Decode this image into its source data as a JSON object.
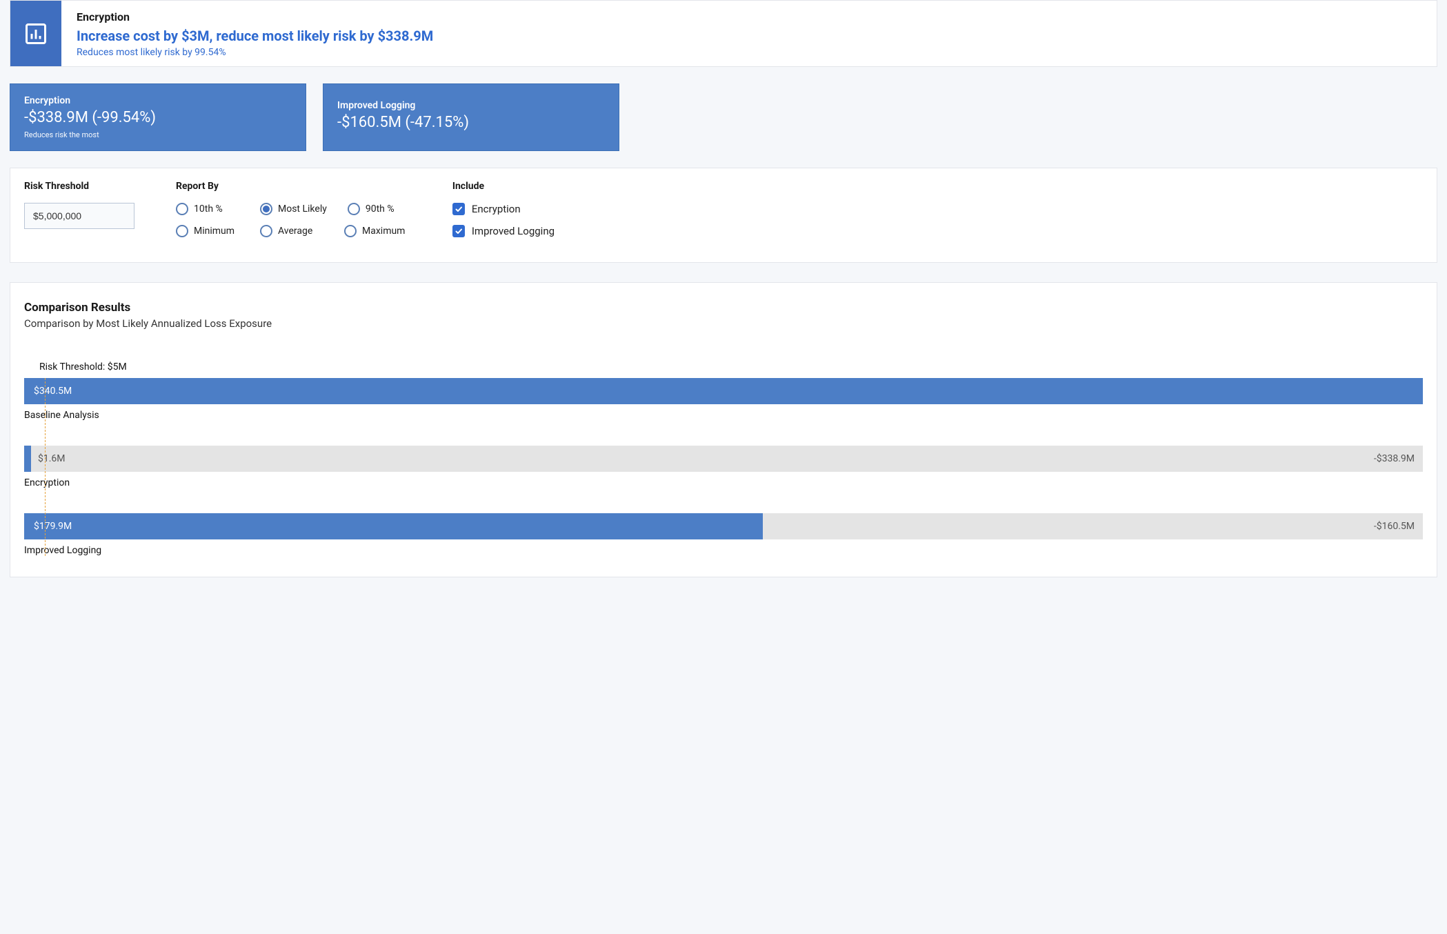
{
  "palette": {
    "primary": "#4c7ec6",
    "primary_dark": "#3f6ebf",
    "link": "#2f6ad0",
    "bar_bg": "#e4e4e4",
    "threshold_line": "#e6a23c"
  },
  "banner": {
    "title": "Encryption",
    "headline": "Increase cost by $3M, reduce most likely risk by $338.9M",
    "sub": "Reduces most likely risk by 99.54%"
  },
  "metric_cards": [
    {
      "title": "Encryption",
      "value": "-$338.9M (-99.54%)",
      "caption": "Reduces risk the most"
    },
    {
      "title": "Improved Logging",
      "value": "-$160.5M (-47.15%)",
      "caption": ""
    }
  ],
  "controls": {
    "risk_threshold_label": "Risk Threshold",
    "risk_threshold_value": "$5,000,000",
    "report_by_label": "Report By",
    "report_by_options": [
      {
        "label": "10th %",
        "checked": false
      },
      {
        "label": "Most Likely",
        "checked": true
      },
      {
        "label": "90th %",
        "checked": false
      },
      {
        "label": "Minimum",
        "checked": false
      },
      {
        "label": "Average",
        "checked": false
      },
      {
        "label": "Maximum",
        "checked": false
      }
    ],
    "include_label": "Include",
    "include_options": [
      {
        "label": "Encryption",
        "checked": true
      },
      {
        "label": "Improved Logging",
        "checked": true
      }
    ]
  },
  "results": {
    "title": "Comparison Results",
    "subtitle": "Comparison by Most Likely Annualized Loss Exposure",
    "threshold_label": "Risk Threshold: $5M"
  },
  "chart_data": {
    "type": "bar",
    "title": "Comparison by Most Likely Annualized Loss Exposure",
    "xlabel": "",
    "ylabel": "",
    "xlim": [
      0,
      340.5
    ],
    "risk_threshold_value_millions": 5,
    "categories": [
      "Baseline Analysis",
      "Encryption",
      "Improved Logging"
    ],
    "series": [
      {
        "name": "Most Likely Annualized Loss Exposure ($M)",
        "values": [
          340.5,
          1.6,
          179.9
        ],
        "value_labels": [
          "$340.5M",
          "$1.6M",
          "$179.9M"
        ]
      }
    ],
    "reduction_vs_baseline_millions": [
      null,
      -338.9,
      -160.5
    ],
    "reduction_labels": [
      "",
      "-$338.9M",
      "-$160.5M"
    ]
  }
}
